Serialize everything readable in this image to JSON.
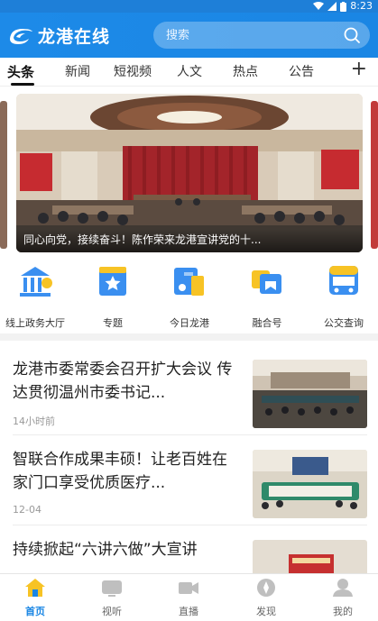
{
  "status_bar": {
    "time": "8:23"
  },
  "header": {
    "logo_text": "龙港在线",
    "search_placeholder": "搜索"
  },
  "tabs": [
    "头条",
    "新闻",
    "短视频",
    "人文",
    "热点",
    "公告"
  ],
  "tab_add_label": "+",
  "carousel": {
    "caption": "同心向党，接续奋斗！陈作荣来龙港宣讲党的十..."
  },
  "shortcuts": [
    {
      "label": "线上政务大厅",
      "icon": "government-hall-icon"
    },
    {
      "label": "专题",
      "icon": "topic-star-icon"
    },
    {
      "label": "今日龙港",
      "icon": "today-longgang-icon"
    },
    {
      "label": "融合号",
      "icon": "media-account-icon"
    },
    {
      "label": "公交查询",
      "icon": "bus-icon"
    }
  ],
  "news": [
    {
      "title": "龙港市委常委会召开扩大会议 传达贯彻温州市委书记...",
      "time": "14小时前"
    },
    {
      "title": "智联合作成果丰硕！让老百姓在家门口享受优质医疗...",
      "time": "12-04"
    },
    {
      "title": "持续掀起“六讲六做”大宣讲",
      "time": ""
    }
  ],
  "bottom_nav": [
    {
      "label": "首页",
      "icon": "home-icon",
      "active": true
    },
    {
      "label": "视听",
      "icon": "tv-icon",
      "active": false
    },
    {
      "label": "直播",
      "icon": "live-camera-icon",
      "active": false
    },
    {
      "label": "发现",
      "icon": "discover-icon",
      "active": false
    },
    {
      "label": "我的",
      "icon": "profile-icon",
      "active": false
    }
  ],
  "colors": {
    "brand": "#1a86e4",
    "accent_yellow": "#f7c325"
  }
}
